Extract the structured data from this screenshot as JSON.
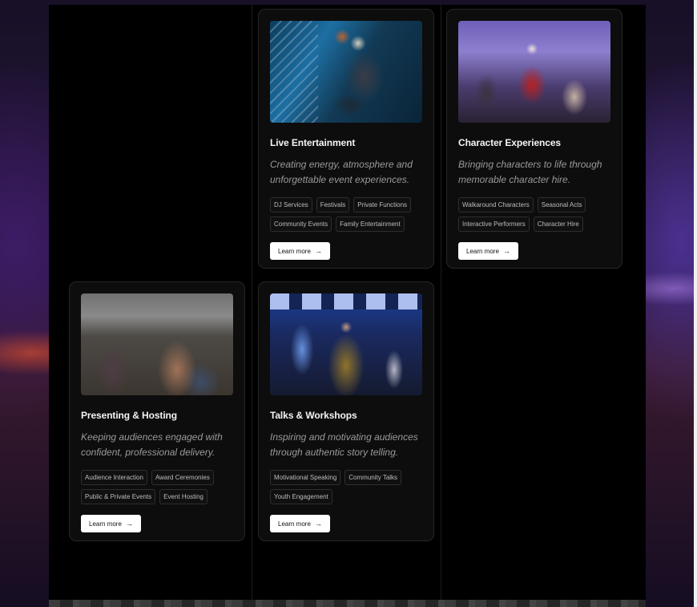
{
  "cards": [
    {
      "title": "Live Entertainment",
      "description": "Creating energy, atmosphere and unforgettable event experiences.",
      "tags": [
        "DJ Services",
        "Festivals",
        "Private Functions",
        "Community Events",
        "Family Entertainment"
      ],
      "button": "Learn more",
      "image_icon": "dj-photo"
    },
    {
      "title": "Character Experiences",
      "description": "Bringing characters to life through memorable character hire.",
      "tags": [
        "Walkaround Characters",
        "Seasonal Acts",
        "Interactive Performers",
        "Character Hire"
      ],
      "button": "Learn more",
      "image_icon": "character-photo"
    },
    {
      "title": "Presenting & Hosting",
      "description": "Keeping audiences engaged with confident, professional delivery.",
      "tags": [
        "Audience Interaction",
        "Award Ceremonies",
        "Public & Private Events",
        "Event Hosting"
      ],
      "button": "Learn more",
      "image_icon": "crowd-photo"
    },
    {
      "title": "Talks & Workshops",
      "description": "Inspiring and motivating audiences through authentic story telling.",
      "tags": [
        "Motivational Speaking",
        "Community Talks",
        "Youth Engagement"
      ],
      "button": "Learn more",
      "image_icon": "speaker-photo"
    }
  ],
  "arrow_glyph": "→"
}
